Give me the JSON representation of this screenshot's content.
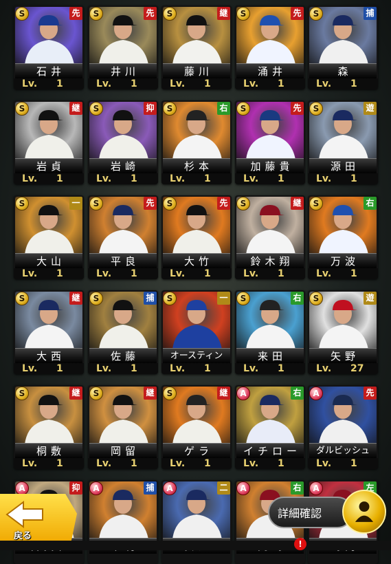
{
  "level_label": "Lv.",
  "cards": [
    {
      "name": "石井",
      "level": "1",
      "rank": "S",
      "position": "先",
      "pos_type": "p",
      "bg": "#6a55d0",
      "uniform": "#e8eef8",
      "cap": "#1a3a90"
    },
    {
      "name": "井川",
      "level": "1",
      "rank": "S",
      "position": "先",
      "pos_type": "p",
      "bg": "#9a8a5a",
      "uniform": "#f0f0ea",
      "cap": "#111111"
    },
    {
      "name": "藤川",
      "level": "1",
      "rank": "S",
      "position": "継",
      "pos_type": "p",
      "bg": "#b89040",
      "uniform": "#f2f2ee",
      "cap": "#111111"
    },
    {
      "name": "涌井",
      "level": "1",
      "rank": "S",
      "position": "先",
      "pos_type": "p",
      "bg": "#e8a030",
      "uniform": "#f0f4ff",
      "cap": "#1e50b0"
    },
    {
      "name": "森",
      "level": "1",
      "rank": "S",
      "position": "捕",
      "pos_type": "c",
      "bg": "#6a7aa0",
      "uniform": "#f0f0f0",
      "cap": "#1a2a60"
    },
    {
      "name": "岩貞",
      "level": "1",
      "rank": "S",
      "position": "継",
      "pos_type": "p",
      "bg": "#b8b8b8",
      "uniform": "#f0f0ea",
      "cap": "#111111"
    },
    {
      "name": "岩崎",
      "level": "1",
      "rank": "S",
      "position": "抑",
      "pos_type": "p",
      "bg": "#8a5ab8",
      "uniform": "#f0f0ea",
      "cap": "#111111"
    },
    {
      "name": "杉本",
      "level": "1",
      "rank": "S",
      "position": "右",
      "pos_type": "i",
      "bg": "#e08a30",
      "uniform": "#f4f4f4",
      "cap": "#222222"
    },
    {
      "name": "加藤貴",
      "level": "1",
      "rank": "S",
      "position": "先",
      "pos_type": "p",
      "bg": "#b030b0",
      "uniform": "#f0f4ff",
      "cap": "#1a3a80"
    },
    {
      "name": "源田",
      "level": "1",
      "rank": "S",
      "position": "遊",
      "pos_type": "o1",
      "bg": "#8a9ab0",
      "uniform": "#f4f4f4",
      "cap": "#1a2a60"
    },
    {
      "name": "大山",
      "level": "1",
      "rank": "S",
      "position": "一",
      "pos_type": "o1",
      "bg": "#d09030",
      "uniform": "#f0f0ea",
      "cap": "#111111"
    },
    {
      "name": "平良",
      "level": "1",
      "rank": "S",
      "position": "先",
      "pos_type": "p",
      "bg": "#d08030",
      "uniform": "#f4f4f4",
      "cap": "#1a2a60"
    },
    {
      "name": "大竹",
      "level": "1",
      "rank": "S",
      "position": "先",
      "pos_type": "p",
      "bg": "#e07a20",
      "uniform": "#f0f0ea",
      "cap": "#111111"
    },
    {
      "name": "鈴木翔",
      "level": "1",
      "rank": "S",
      "position": "継",
      "pos_type": "p",
      "bg": "#c0b0a0",
      "uniform": "#f4f4f4",
      "cap": "#8a1020"
    },
    {
      "name": "万波",
      "level": "1",
      "rank": "S",
      "position": "右",
      "pos_type": "i",
      "bg": "#e07a20",
      "uniform": "#f0f4ff",
      "cap": "#1e50b0"
    },
    {
      "name": "大西",
      "level": "1",
      "rank": "S",
      "position": "継",
      "pos_type": "p",
      "bg": "#7a8aa0",
      "uniform": "#f4f4f4",
      "cap": "#1a2a60"
    },
    {
      "name": "佐藤",
      "level": "1",
      "rank": "S",
      "position": "捕",
      "pos_type": "c",
      "bg": "#a08040",
      "uniform": "#f0f0ea",
      "cap": "#111111"
    },
    {
      "name": "オースティン",
      "level": "1",
      "rank": "S",
      "position": "一",
      "pos_type": "o1",
      "bg": "#d04020",
      "uniform": "#1e40a0",
      "cap": "#1e40a0",
      "long": true
    },
    {
      "name": "来田",
      "level": "1",
      "rank": "S",
      "position": "右",
      "pos_type": "i",
      "bg": "#4aa0d0",
      "uniform": "#f4f4f4",
      "cap": "#222222"
    },
    {
      "name": "矢野",
      "level": "27",
      "rank": "S",
      "position": "遊",
      "pos_type": "o1",
      "bg": "#e0e0e0",
      "uniform": "#f4f4f4",
      "cap": "#c01020"
    },
    {
      "name": "桐敷",
      "level": "1",
      "rank": "S",
      "position": "継",
      "pos_type": "p",
      "bg": "#c89040",
      "uniform": "#f0f0ea",
      "cap": "#111111"
    },
    {
      "name": "岡留",
      "level": "1",
      "rank": "S",
      "position": "継",
      "pos_type": "p",
      "bg": "#d09040",
      "uniform": "#f0f0ea",
      "cap": "#111111"
    },
    {
      "name": "ゲラ",
      "level": "1",
      "rank": "S",
      "position": "継",
      "pos_type": "p",
      "bg": "#e07a20",
      "uniform": "#f0f0ea",
      "cap": "#222222"
    },
    {
      "name": "イチロー",
      "level": "1",
      "rank": "A",
      "position": "右",
      "pos_type": "i",
      "bg": "#c0a040",
      "uniform": "#e8ecf8",
      "cap": "#1a2a60"
    },
    {
      "name": "ダルビッシュ",
      "level": "1",
      "rank": "A",
      "position": "先",
      "pos_type": "p",
      "bg": "#3050a0",
      "uniform": "#f0f0f0",
      "cap": "#1a2a50",
      "long": true
    },
    {
      "name": "岩貴佳",
      "level": "",
      "rank": "A",
      "position": "抑",
      "pos_type": "p",
      "bg": "#c0a880",
      "uniform": "#f0f0ea",
      "cap": "#111111"
    },
    {
      "name": "中村",
      "level": "",
      "rank": "A",
      "position": "捕",
      "pos_type": "c",
      "bg": "#d08030",
      "uniform": "#f0f0f0",
      "cap": "#1a2a60"
    },
    {
      "name": "安達",
      "level": "",
      "rank": "A",
      "position": "二",
      "pos_type": "o1",
      "bg": "#4a6ab0",
      "uniform": "#f0f0f0",
      "cap": "#1a2a60"
    },
    {
      "name": "岡島",
      "level": "",
      "rank": "A",
      "position": "右",
      "pos_type": "i",
      "bg": "#d08030",
      "uniform": "#f0f0f0",
      "cap": "#8a1020"
    },
    {
      "name": "島内",
      "level": "",
      "rank": "A",
      "position": "左",
      "pos_type": "i",
      "bg": "#c03040",
      "uniform": "#f0f0f0",
      "cap": "#8a1020"
    }
  ],
  "back_button": {
    "label": "戻る"
  },
  "detail_button": {
    "label": "詳細確認"
  },
  "alert_badge": "!"
}
